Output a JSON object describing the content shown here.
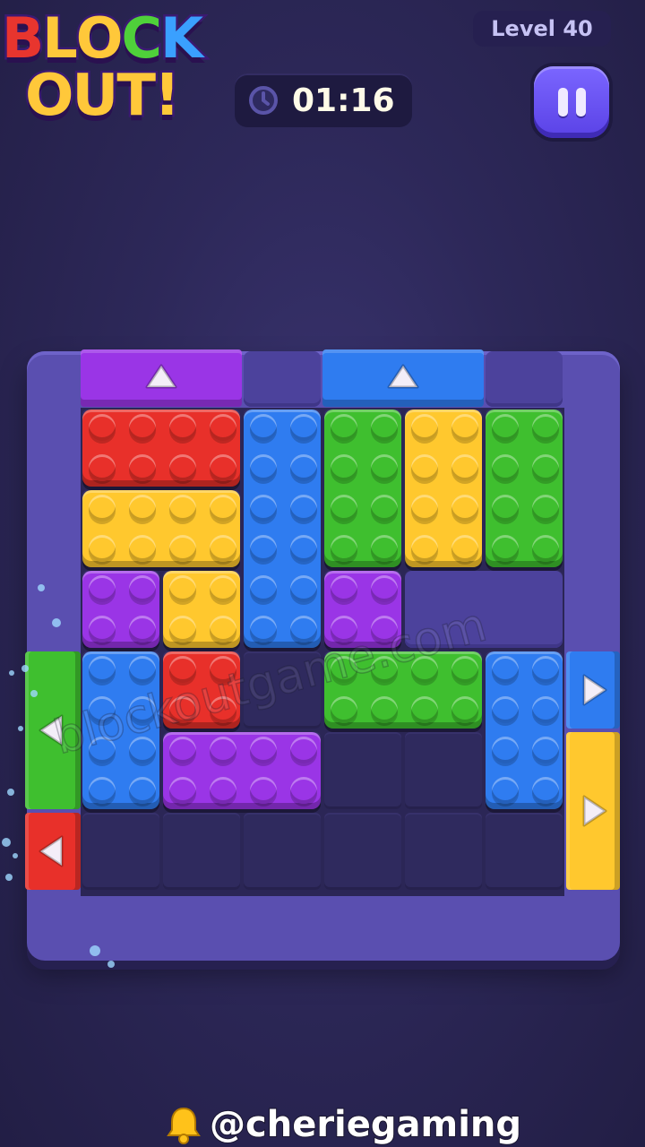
{
  "logo": {
    "line1": [
      "B",
      "L",
      "O",
      "C",
      "K"
    ],
    "line2": [
      "O",
      "U",
      "T",
      "!"
    ],
    "colors": [
      "#e8352e",
      "#ffc83a",
      "#ffc83a",
      "#4fd03a",
      "#3aa0ff"
    ],
    "colors2": [
      "#ffc83a",
      "#ffc83a",
      "#ffc83a",
      "#ffc83a"
    ]
  },
  "hud": {
    "level_label": "Level 40",
    "timer": "01:16",
    "clock_icon": "clock-icon",
    "pause_icon": "pause-icon"
  },
  "colors": {
    "red": "#e8302a",
    "yellow": "#ffc82e",
    "blue": "#2f7cf0",
    "green": "#3fbf2f",
    "purple": "#9a35e6"
  },
  "board": {
    "cols": 6,
    "rows": 6,
    "gates": [
      {
        "color": "purple",
        "side": "top",
        "col": 0,
        "span": 2,
        "arrow": "up"
      },
      {
        "color": "blue",
        "side": "top",
        "col": 3,
        "span": 2,
        "arrow": "up"
      },
      {
        "color": "green",
        "side": "left",
        "row": 3,
        "span": 2,
        "arrow": "left"
      },
      {
        "color": "red",
        "side": "left",
        "row": 5,
        "span": 1,
        "arrow": "left"
      },
      {
        "color": "blue",
        "side": "right",
        "row": 3,
        "span": 1,
        "arrow": "right"
      },
      {
        "color": "yellow",
        "side": "right",
        "row": 4,
        "span": 2,
        "arrow": "right"
      }
    ],
    "walls": [
      {
        "row": 2,
        "col": 4,
        "w": 2,
        "h": 1
      }
    ],
    "blocks": [
      {
        "color": "red",
        "col": 0,
        "row": 0,
        "w": 2,
        "h": 1
      },
      {
        "color": "blue",
        "col": 2,
        "row": 0,
        "w": 1,
        "h": 3
      },
      {
        "color": "green",
        "col": 3,
        "row": 0,
        "w": 1,
        "h": 2
      },
      {
        "color": "yellow",
        "col": 4,
        "row": 0,
        "w": 1,
        "h": 2
      },
      {
        "color": "green",
        "col": 5,
        "row": 0,
        "w": 1,
        "h": 2
      },
      {
        "color": "yellow",
        "col": 0,
        "row": 1,
        "w": 2,
        "h": 1
      },
      {
        "color": "yellow",
        "col": 1,
        "row": 2,
        "w": 1,
        "h": 1
      },
      {
        "color": "purple",
        "col": 0,
        "row": 2,
        "w": 1,
        "h": 1
      },
      {
        "color": "purple",
        "col": 3,
        "row": 2,
        "w": 1,
        "h": 1
      },
      {
        "color": "blue",
        "col": 0,
        "row": 3,
        "w": 1,
        "h": 2
      },
      {
        "color": "red",
        "col": 1,
        "row": 3,
        "w": 1,
        "h": 1
      },
      {
        "color": "green",
        "col": 3,
        "row": 3,
        "w": 2,
        "h": 1
      },
      {
        "color": "blue",
        "col": 5,
        "row": 3,
        "w": 1,
        "h": 2
      },
      {
        "color": "purple",
        "col": 1,
        "row": 4,
        "w": 2,
        "h": 1
      }
    ]
  },
  "watermark": "blockoutgame.com",
  "credit": {
    "bell_icon": "bell-icon",
    "handle": "@cheriegaming"
  }
}
